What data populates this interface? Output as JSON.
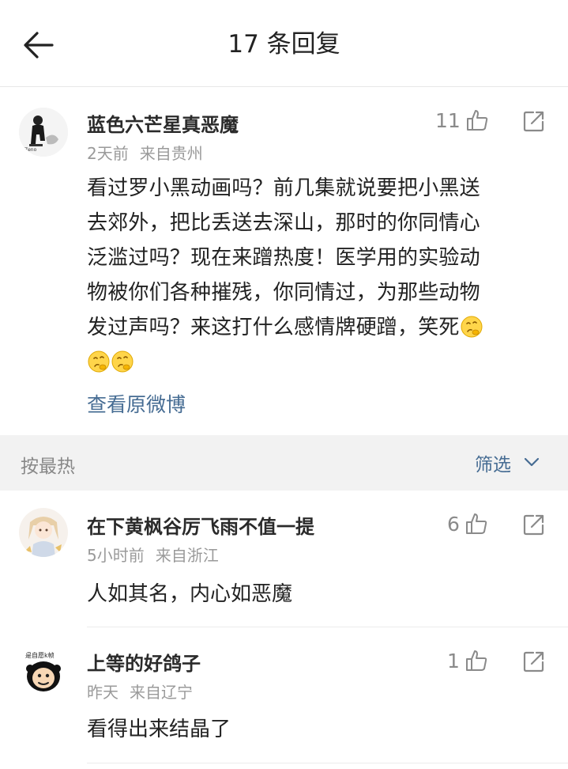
{
  "header": {
    "title": "17 条回复"
  },
  "main_comment": {
    "username": "蓝色六芒星真恶魔",
    "time": "2天前",
    "location": "来自贵州",
    "likes": "11",
    "lines": [
      "看过罗小黑动画吗？前几集就说要把小黑送",
      "去郊外，把比丢送去深山，那时的你同情心",
      "泛滥过吗？现在来蹭热度！医学用的实验动",
      "物被你们各种摧残，你同情过，为那些动物",
      "发过声吗？来这打什么感情牌硬蹭，笑死"
    ],
    "view_original": "查看原微博"
  },
  "sort_bar": {
    "sort_label": "按最热",
    "filter_label": "筛选"
  },
  "replies": [
    {
      "username": "在下黄枫谷厉飞雨不值一提",
      "time": "5小时前",
      "location": "来自浙江",
      "likes": "6",
      "text": "人如其名，内心如恶魔"
    },
    {
      "username": "上等的好鸽子",
      "time": "昨天",
      "location": "来自辽宁",
      "likes": "1",
      "text": "看得出来结晶了"
    }
  ],
  "icons": {
    "back": "back-arrow-icon",
    "like": "thumb-up-icon",
    "share": "share-icon",
    "filter": "chevron-down-icon",
    "emoji": "thinking-face-emoji"
  },
  "colors": {
    "link": "#466c93",
    "meta": "#9a9a9a",
    "sort_bar_bg": "#f2f2f2"
  }
}
